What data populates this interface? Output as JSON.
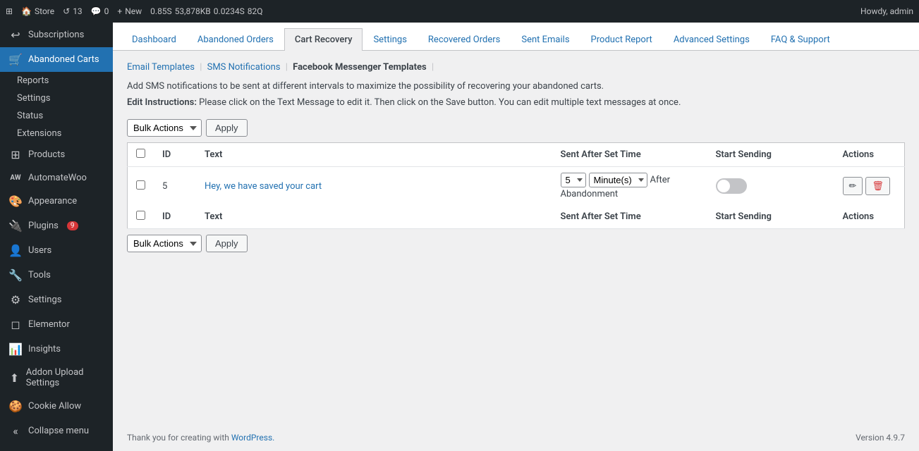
{
  "adminBar": {
    "store": "Store",
    "updates": "13",
    "comments": "0",
    "new": "New",
    "perf": "0.85S",
    "memory": "53,878KB",
    "time": "0.0234S",
    "queries": "82Q",
    "howdy": "Howdy, admin"
  },
  "sidebar": {
    "subscriptions": "Subscriptions",
    "abandonedCarts": "Abandoned Carts",
    "submenu": [
      {
        "key": "reports",
        "label": "Reports"
      },
      {
        "key": "settings",
        "label": "Settings"
      },
      {
        "key": "status",
        "label": "Status"
      },
      {
        "key": "extensions",
        "label": "Extensions"
      }
    ],
    "items": [
      {
        "key": "products",
        "label": "Products",
        "icon": "⊞"
      },
      {
        "key": "automatewoo",
        "label": "AutomateWoo",
        "icon": "AW"
      },
      {
        "key": "appearance",
        "label": "Appearance",
        "icon": "🎨"
      },
      {
        "key": "plugins",
        "label": "Plugins",
        "badge": "9",
        "icon": "🔌"
      },
      {
        "key": "users",
        "label": "Users",
        "icon": "👤"
      },
      {
        "key": "tools",
        "label": "Tools",
        "icon": "🔧"
      },
      {
        "key": "settings-main",
        "label": "Settings",
        "icon": "⚙"
      },
      {
        "key": "elementor",
        "label": "Elementor",
        "icon": "◻"
      },
      {
        "key": "insights",
        "label": "Insights",
        "icon": "📊"
      },
      {
        "key": "addon-upload",
        "label": "Addon Upload Settings",
        "icon": "⬆"
      },
      {
        "key": "cookie-allow",
        "label": "Cookie Allow",
        "icon": "🍪"
      },
      {
        "key": "collapse",
        "label": "Collapse menu",
        "icon": "«"
      }
    ]
  },
  "tabs": [
    {
      "key": "dashboard",
      "label": "Dashboard"
    },
    {
      "key": "abandoned-orders",
      "label": "Abandoned Orders"
    },
    {
      "key": "cart-recovery",
      "label": "Cart Recovery",
      "active": true
    },
    {
      "key": "settings",
      "label": "Settings"
    },
    {
      "key": "recovered-orders",
      "label": "Recovered Orders"
    },
    {
      "key": "sent-emails",
      "label": "Sent Emails"
    },
    {
      "key": "product-report",
      "label": "Product Report"
    },
    {
      "key": "advanced-settings",
      "label": "Advanced Settings"
    },
    {
      "key": "faq-support",
      "label": "FAQ & Support"
    }
  ],
  "subNav": [
    {
      "key": "email-templates",
      "label": "Email Templates",
      "active": false
    },
    {
      "key": "sms-notifications",
      "label": "SMS Notifications",
      "active": false
    },
    {
      "key": "facebook-messenger",
      "label": "Facebook Messenger Templates",
      "active": true
    }
  ],
  "descText": "Add SMS notifications to be sent at different intervals to maximize the possibility of recovering your abandoned carts.",
  "editInstructions": {
    "label": "Edit Instructions:",
    "text": "Please click on the Text Message to edit it. Then click on the Save button. You can edit multiple text messages at once."
  },
  "bulkActionsLabel": "Bulk Actions",
  "applyLabel": "Apply",
  "table": {
    "headers": [
      "",
      "ID",
      "Text",
      "Sent After Set Time",
      "Start Sending",
      "Actions"
    ],
    "rows": [
      {
        "id": "5",
        "text": "Hey, we have saved your cart",
        "timeValue": "5",
        "timeUnit": "Minute(s)",
        "timeLabel": "After Abandonment",
        "startSending": false
      }
    ],
    "footerHeaders": [
      "",
      "ID",
      "Text",
      "Sent After Set Time",
      "Start Sending",
      "Actions"
    ]
  },
  "footer": {
    "thankYou": "Thank you for creating with ",
    "wordpressLink": "WordPress.",
    "version": "Version 4.9.7"
  }
}
